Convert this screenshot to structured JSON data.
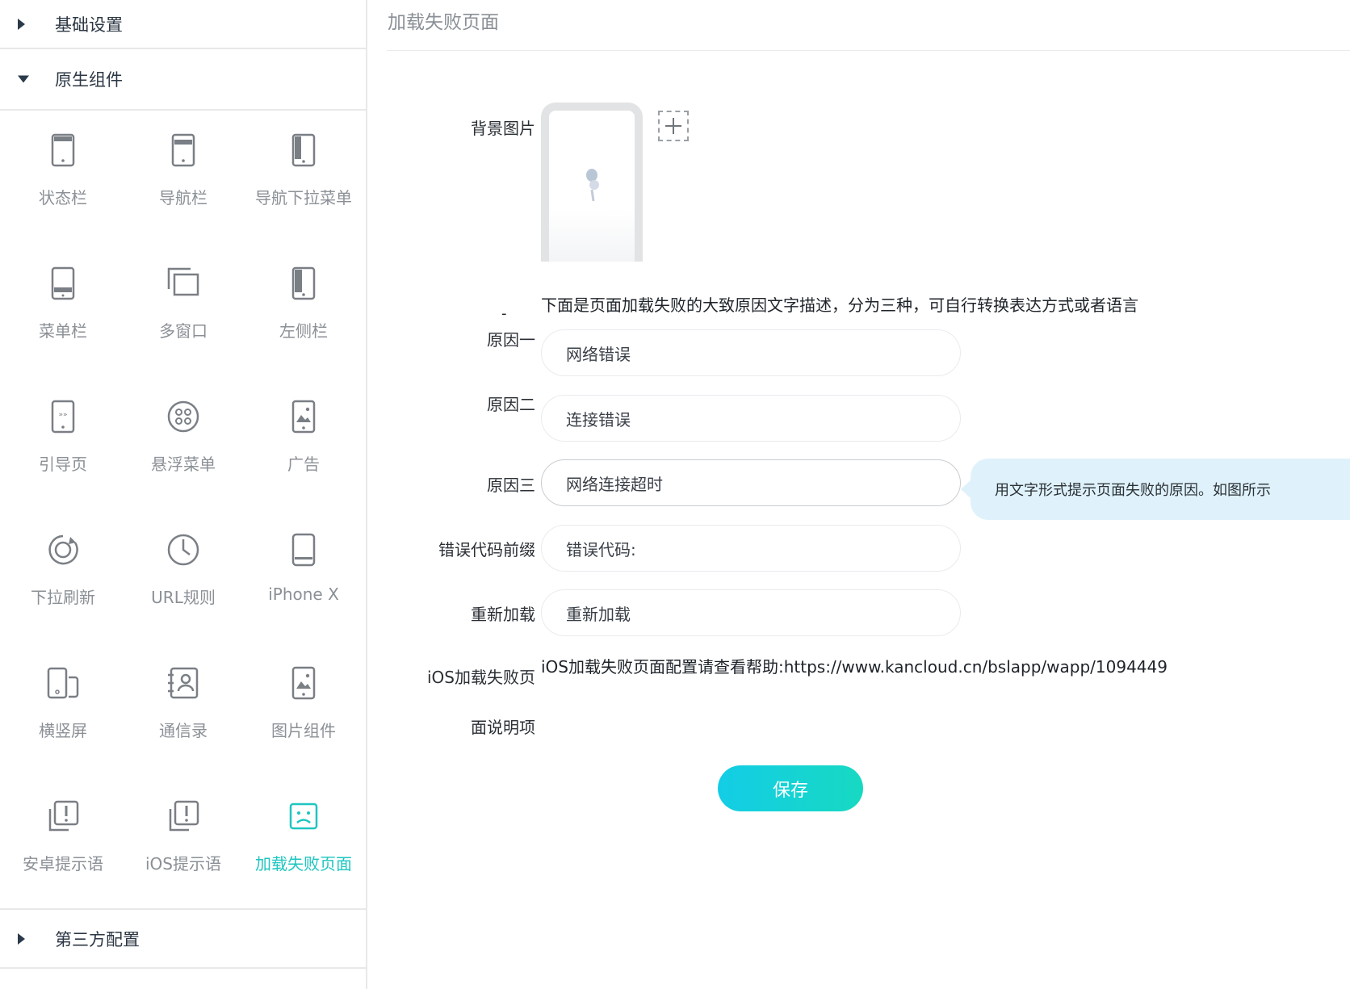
{
  "sidebar": {
    "sections": {
      "basic": "基础设置",
      "native": "原生组件",
      "third_party": "第三方配置"
    },
    "components": [
      {
        "label": "状态栏",
        "icon": "phone-status-bar-icon"
      },
      {
        "label": "导航栏",
        "icon": "phone-nav-bar-icon"
      },
      {
        "label": "导航下拉菜单",
        "icon": "phone-dropdown-icon"
      },
      {
        "label": "菜单栏",
        "icon": "phone-menu-bar-icon"
      },
      {
        "label": "多窗口",
        "icon": "multi-window-icon"
      },
      {
        "label": "左侧栏",
        "icon": "phone-left-sidebar-icon"
      },
      {
        "label": "引导页",
        "icon": "phone-guide-icon"
      },
      {
        "label": "悬浮菜单",
        "icon": "floating-menu-icon"
      },
      {
        "label": "广告",
        "icon": "phone-ad-image-icon"
      },
      {
        "label": "下拉刷新",
        "icon": "refresh-icon"
      },
      {
        "label": "URL规则",
        "icon": "clock-icon"
      },
      {
        "label": "iPhone X",
        "icon": "iphone-x-icon"
      },
      {
        "label": "横竖屏",
        "icon": "rotate-screen-icon"
      },
      {
        "label": "通信录",
        "icon": "contacts-icon"
      },
      {
        "label": "图片组件",
        "icon": "phone-image-icon"
      },
      {
        "label": "安卓提示语",
        "icon": "android-alert-icon"
      },
      {
        "label": "iOS提示语",
        "icon": "ios-alert-icon"
      },
      {
        "label": "加载失败页面",
        "icon": "sad-face-icon"
      }
    ],
    "active_index": 17,
    "colors": {
      "active": "#1ec6c0",
      "inactive": "#8b9096"
    }
  },
  "main": {
    "title": "加载失败页面",
    "background_label": "背景图片",
    "description": "下面是页面加载失败的大致原因文字描述，分为三种，可自行转换表达方式或者语言",
    "dash": "-",
    "reason1_label": "原因一",
    "reason1_value": "网络错误",
    "reason2_label": "原因二",
    "reason2_value": "连接错误",
    "reason3_label": "原因三",
    "reason3_value": "网络连接超时",
    "tooltip": "用文字形式提示页面失败的原因。如图所示",
    "error_prefix_label": "错误代码前缀",
    "error_prefix_value": "错误代码:",
    "reload_label": "重新加载",
    "reload_value": "重新加载",
    "ios_note_label_line1": "iOS加载失败页",
    "ios_note_label_line2": "面说明项",
    "ios_help": "iOS加载失败页面配置请查看帮助:https://www.kancloud.cn/bslapp/wapp/1094449",
    "save_label": "保存"
  }
}
